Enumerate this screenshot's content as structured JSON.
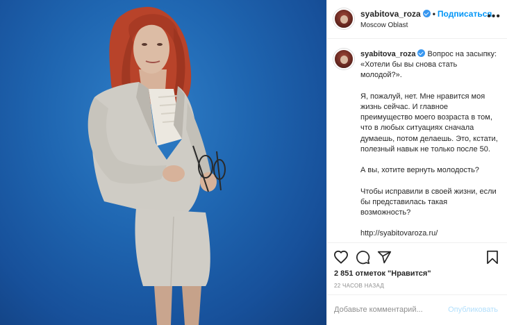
{
  "post": {
    "username": "syabitova_roza",
    "follow_label": "Подписаться",
    "separator": "•",
    "location": "Moscow Oblast",
    "more_label": "•••"
  },
  "caption": {
    "username": "syabitova_roza",
    "text": "Вопрос на засыпку: «Хотели бы вы снова стать молодой?».\n\nЯ, пожалуй, нет. Мне нравится моя жизнь сейчас. И главное преимущество моего возраста в том, что в любых ситуациях сначала думаешь, потом делаешь. Это, кстати, полезный навык не только после 50.\n\nА вы, хотите вернуть молодость?\n\nЧтобы исправили в своей жизни, если бы представилась такая возможность?\n\nhttp://syabitovaroza.ru/"
  },
  "stats": {
    "likes": "2 851 отметок \"Нравится\"",
    "time_ago": "22 ЧАСОВ НАЗАД"
  },
  "comment": {
    "placeholder": "Добавьте комментарий...",
    "publish_label": "Опубликовать"
  },
  "icons": {
    "like": "heart-icon",
    "comment": "comment-icon",
    "share": "share-icon",
    "save": "bookmark-icon",
    "verified": "verified-badge-icon"
  },
  "colors": {
    "accent": "#0095f6",
    "verified": "#3897f0",
    "publish_disabled": "#b2dffc",
    "photo_background": "#1f66b1"
  }
}
